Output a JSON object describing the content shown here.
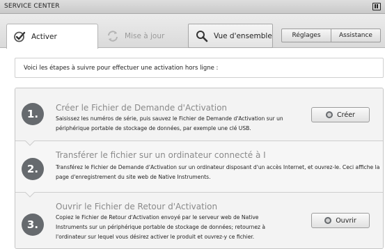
{
  "window": {
    "title": "SERVICE CENTER",
    "logo_icon": "native-instruments-logo-icon"
  },
  "tabs": [
    {
      "label": "Activer",
      "icon": "checkmark-icon",
      "state": "active"
    },
    {
      "label": "Mise à jour",
      "icon": "refresh-icon",
      "state": "disabled"
    },
    {
      "label": "Vue d'ensemble",
      "icon": "magnifier-icon",
      "state": "normal"
    }
  ],
  "header_buttons": {
    "reglages": "Réglages",
    "assistance": "Assistance"
  },
  "intro": "Voici les étapes à suivre pour effectuer une activation hors ligne :",
  "steps": [
    {
      "number": "1.",
      "title": "Créer le Fichier de Demande d'Activation",
      "description": "Saisissez les numéros de série, puis sauvez le Fichier de Demande d'Activation sur un périphérique portable de stockage de données, par exemple une clé USB.",
      "button": "Créer"
    },
    {
      "number": "2.",
      "title": "Transférer le fichier sur un ordinateur connecté à I",
      "description": "Transférez le Fichier de Demande d'Activation sur un ordinateur disposant d'un accès Internet, et ouvrez-le. Ceci affiche la page d'enregistrement du site web de Native Instruments."
    },
    {
      "number": "3.",
      "title": "Ouvrir le Fichier de Retour d'Activation",
      "description": "Copiez le Fichier de Retour d'Activation envoyé par le serveur web de Native Instruments sur un périphérique portable de stockage de données; retournez à l'ordinateur sur lequel vous désirez activer le produit et ouvrez-y ce fichier.",
      "button": "Ouvrir"
    }
  ],
  "colors": {
    "circle": "#666a6e",
    "step_title": "#8a8a8a",
    "panel": "#f1f1f1"
  }
}
